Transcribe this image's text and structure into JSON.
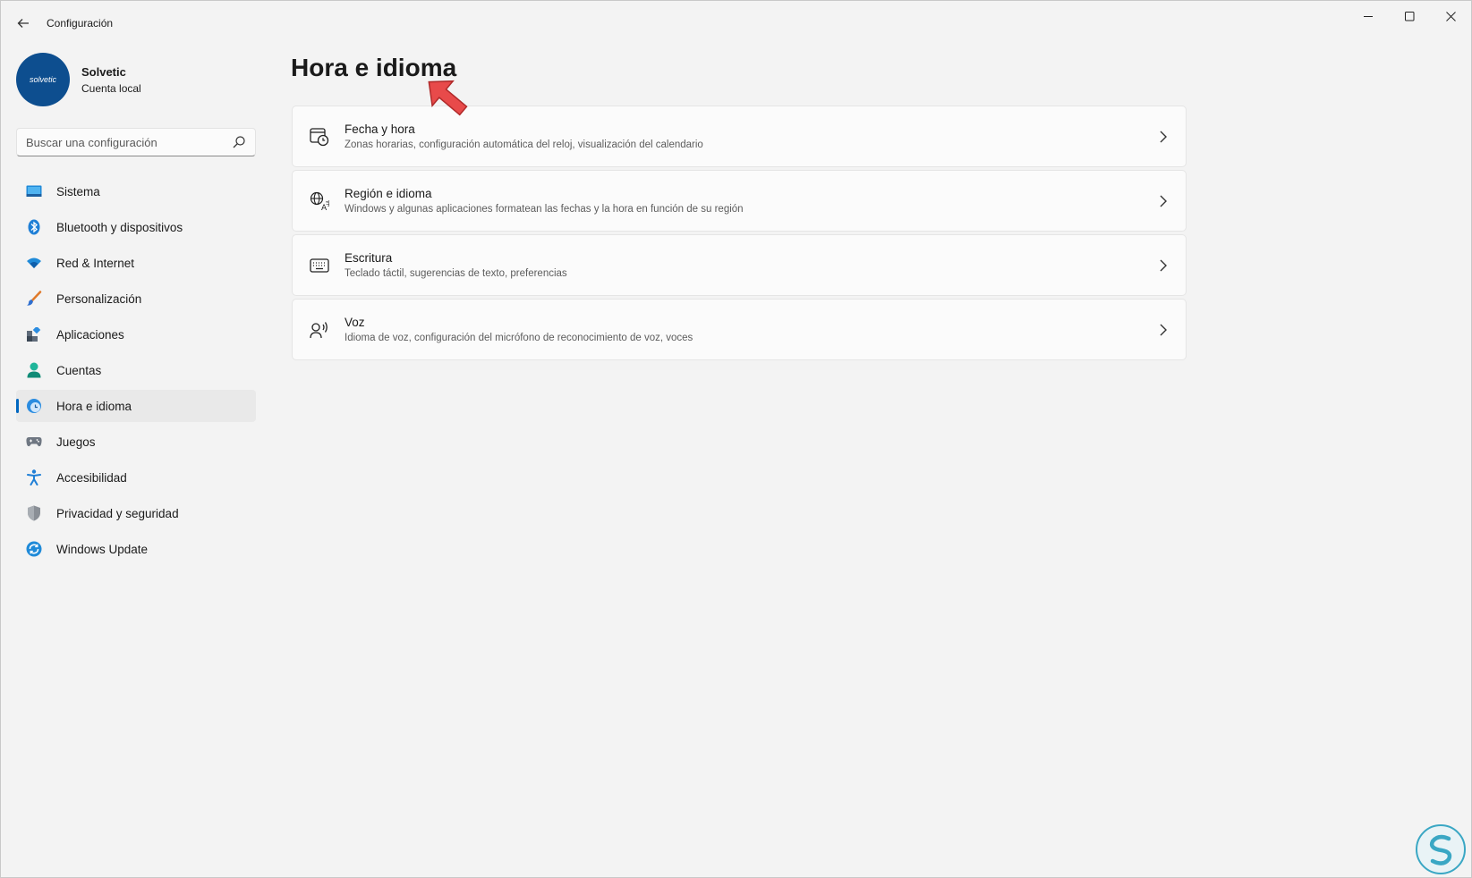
{
  "titlebar": {
    "title": "Configuración",
    "back_icon": "arrow-left-icon",
    "controls": [
      "minimize-icon",
      "maximize-icon",
      "close-icon"
    ]
  },
  "profile": {
    "avatar_text": "solvetic",
    "name": "Solvetic",
    "account_type": "Cuenta local"
  },
  "search": {
    "placeholder": "Buscar una configuración",
    "value": ""
  },
  "sidebar": {
    "items": [
      {
        "label": "Sistema",
        "icon": "monitor-icon",
        "active": false
      },
      {
        "label": "Bluetooth y dispositivos",
        "icon": "bluetooth-icon",
        "active": false
      },
      {
        "label": "Red & Internet",
        "icon": "wifi-icon",
        "active": false
      },
      {
        "label": "Personalización",
        "icon": "brush-icon",
        "active": false
      },
      {
        "label": "Aplicaciones",
        "icon": "apps-icon",
        "active": false
      },
      {
        "label": "Cuentas",
        "icon": "person-icon",
        "active": false
      },
      {
        "label": "Hora e idioma",
        "icon": "clock-globe-icon",
        "active": true
      },
      {
        "label": "Juegos",
        "icon": "gamepad-icon",
        "active": false
      },
      {
        "label": "Accesibilidad",
        "icon": "accessibility-icon",
        "active": false
      },
      {
        "label": "Privacidad y seguridad",
        "icon": "shield-icon",
        "active": false
      },
      {
        "label": "Windows Update",
        "icon": "sync-icon",
        "active": false
      }
    ]
  },
  "main": {
    "title": "Hora e idioma",
    "cards": [
      {
        "title": "Fecha y hora",
        "description": "Zonas horarias, configuración automática del reloj, visualización del calendario",
        "icon": "calendar-clock-icon"
      },
      {
        "title": "Región e idioma",
        "description": "Windows y algunas aplicaciones formatean las fechas y la hora en función de su región",
        "icon": "language-icon"
      },
      {
        "title": "Escritura",
        "description": "Teclado táctil, sugerencias de texto, preferencias",
        "icon": "keyboard-icon"
      },
      {
        "title": "Voz",
        "description": "Idioma de voz, configuración del micrófono de reconocimiento de voz, voces",
        "icon": "speech-icon"
      }
    ]
  },
  "colors": {
    "accent": "#0067c0",
    "background": "#f3f3f3",
    "card": "#fbfbfb",
    "annotation_arrow": "#e84a4a"
  }
}
